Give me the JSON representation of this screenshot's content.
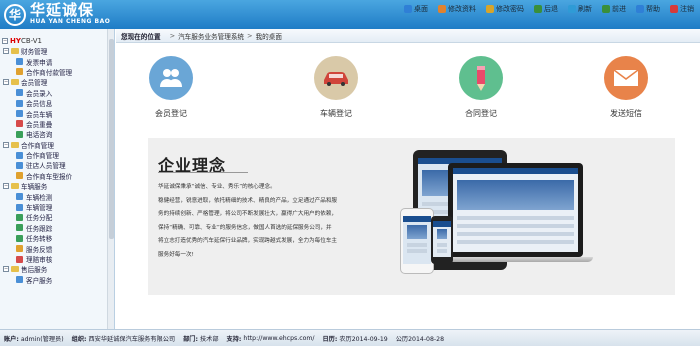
{
  "header": {
    "logo_mark": "华",
    "logo_cn": "华延诚保",
    "logo_en": "HUA YAN CHENG BAO",
    "nav": [
      {
        "label": "桌面",
        "icon": "desktop-icon",
        "color": "#2f7fd6"
      },
      {
        "label": "修改资料",
        "icon": "user-edit-icon",
        "color": "#e0822f"
      },
      {
        "label": "修改密码",
        "icon": "key-icon",
        "color": "#d7a52a"
      },
      {
        "label": "后退",
        "icon": "back-arrow-icon",
        "color": "#3a8f3a"
      },
      {
        "label": "刷新",
        "icon": "refresh-icon",
        "color": "#2f9bd6"
      },
      {
        "label": "前进",
        "icon": "forward-arrow-icon",
        "color": "#3a8f3a"
      },
      {
        "label": "帮助",
        "icon": "help-icon",
        "color": "#2f7fd6"
      },
      {
        "label": "注销",
        "icon": "logout-icon",
        "color": "#d63a3a"
      }
    ]
  },
  "sidebar": {
    "root": {
      "prefix": "HY",
      "suffix": "CB-V1"
    },
    "groups": [
      {
        "label": "财务管理",
        "items": [
          {
            "label": "发票申请",
            "color": "#4a8fd6"
          },
          {
            "label": "合作商付款管理",
            "color": "#e0a12f"
          }
        ]
      },
      {
        "label": "会员管理",
        "items": [
          {
            "label": "会员录入",
            "color": "#4a8fd6"
          },
          {
            "label": "会员信息",
            "color": "#4a8fd6"
          },
          {
            "label": "会员车辆",
            "color": "#4a8fd6"
          },
          {
            "label": "会员重疊",
            "color": "#d64a4a"
          },
          {
            "label": "电话咨询",
            "color": "#3a9f5a"
          }
        ]
      },
      {
        "label": "合作商管理",
        "items": [
          {
            "label": "合作商管理",
            "color": "#4a8fd6"
          },
          {
            "label": "驻店人员管理",
            "color": "#4a8fd6"
          },
          {
            "label": "合作商车型报价",
            "color": "#e0a12f"
          }
        ]
      },
      {
        "label": "车辆服务",
        "items": [
          {
            "label": "车辆检测",
            "color": "#4a8fd6"
          },
          {
            "label": "车辆管理",
            "color": "#4a8fd6"
          },
          {
            "label": "任务分配",
            "color": "#3a9f5a"
          },
          {
            "label": "任务跟踪",
            "color": "#3a9f5a"
          },
          {
            "label": "任务转移",
            "color": "#3a9f5a"
          },
          {
            "label": "服务反馈",
            "color": "#e0a12f"
          },
          {
            "label": "理赔审核",
            "color": "#d64a4a"
          }
        ]
      },
      {
        "label": "售后服务",
        "items": [
          {
            "label": "客户服务",
            "color": "#4a8fd6"
          }
        ]
      }
    ]
  },
  "breadcrumb": {
    "lead": "您现在的位置",
    "path": [
      "汽车服务业务管理系统",
      "我的桌面"
    ]
  },
  "quick_actions": [
    {
      "label": "会员登记",
      "icon": "users-icon",
      "color": "#6aa6d6"
    },
    {
      "label": "车辆登记",
      "icon": "car-icon",
      "color": "#d9c9a8"
    },
    {
      "label": "合同登记",
      "icon": "pencil-icon",
      "color": "#5fbf8f"
    },
    {
      "label": "发送短信",
      "icon": "envelope-icon",
      "color": "#e8834a"
    }
  ],
  "panel": {
    "title": "企业理念",
    "paragraphs": [
      "华延诚保秉承“诚信、专业、秀乐”的核心理念。",
      "稳健经营，锐意进取，依托精细的技术、精良的产品，立足通过产品和服",
      "务的持续创新、严格管理，将公司不断发展壮大，赢得广大用户的依赖，",
      "保持“精确、可靠、专业”的服务信念，做国人首选的延保服务公司，并",
      "将立志打造优秀的汽车延保行业品牌，实现跨越式发展，全力为每位车主",
      "服务好每一次!"
    ]
  },
  "footer": {
    "account_label": "账户:",
    "account_value": "admin(管理员)",
    "org_label": "组织:",
    "org_value": "西安华延诚保汽车服务有限公司",
    "dept_label": "部门:",
    "dept_value": "技术部",
    "support_label": "支持:",
    "support_value": "http://www.ehcps.com/",
    "date_label": "日历:",
    "date_value": "农历2014-09-19",
    "lunar_value": "公历2014-08-28"
  }
}
